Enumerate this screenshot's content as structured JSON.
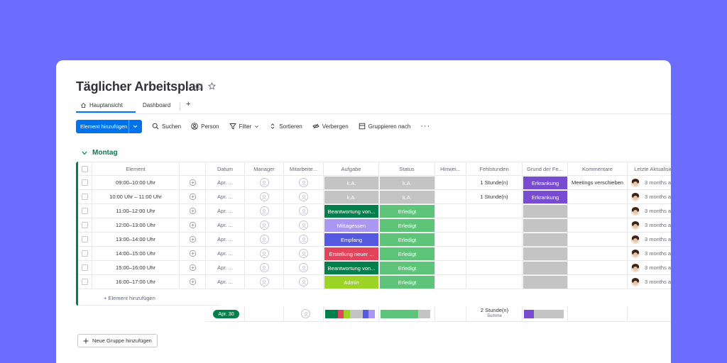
{
  "title": "Täglicher Arbeitsplan",
  "tabs": [
    {
      "label": "Hauptansicht",
      "icon": "home-icon"
    },
    {
      "label": "Dashboard"
    },
    {
      "label": "+"
    }
  ],
  "toolbar": {
    "primary": "Element hinzufügen",
    "items": [
      {
        "label": "Suchen",
        "icon": "search-icon"
      },
      {
        "label": "Person",
        "icon": "person-icon"
      },
      {
        "label": "Filter",
        "icon": "filter-icon"
      },
      {
        "label": "Sortieren",
        "icon": "sort-icon"
      },
      {
        "label": "Verbergen",
        "icon": "eye-off-icon"
      },
      {
        "label": "Gruppieren nach",
        "icon": "group-icon"
      }
    ],
    "more": "···"
  },
  "group": {
    "title": "Montag",
    "color": "#037f4c",
    "columns": [
      "Element",
      "Datum",
      "Manager",
      "Mitarbeite...",
      "Aufgabe",
      "Status",
      "Hinwei...",
      "Fehlstunden",
      "Grund der Fe...",
      "Kommentare",
      "Letzte Aktualisie..."
    ],
    "rows": [
      {
        "element": "09:00–10:00 Uhr",
        "datum": "Apr. ...",
        "aufgabe": "k.A.",
        "aufgabe_color": "#c4c4c4",
        "status": "k.A.",
        "status_color": "#c4c4c4",
        "fehlstunden": "1 Stunde(n)",
        "grund": "Erkrankung",
        "grund_color": "#784bd1",
        "kommentar": "Meetings verschieben",
        "updated": "3 months a..."
      },
      {
        "element": "10:00 Uhr – 11:00 Uhr",
        "datum": "Apr. ...",
        "aufgabe": "k.A.",
        "aufgabe_color": "#c4c4c4",
        "status": "k.A.",
        "status_color": "#c4c4c4",
        "fehlstunden": "1 Stunde(n)",
        "grund": "Erkrankung",
        "grund_color": "#784bd1",
        "kommentar": "",
        "updated": "3 months a..."
      },
      {
        "element": "11:00–12:00 Uhr",
        "datum": "Apr. ...",
        "aufgabe": "Beantwortung von...",
        "aufgabe_color": "#037f4c",
        "status": "Erledigt",
        "status_color": "#5ec47a",
        "fehlstunden": "",
        "grund": "",
        "grund_color": "#c4c4c4",
        "kommentar": "",
        "updated": "3 months a..."
      },
      {
        "element": "12:00–13:00 Uhr",
        "datum": "Apr. ...",
        "aufgabe": "Mittagessen",
        "aufgabe_color": "#a997f0",
        "status": "Erledigt",
        "status_color": "#5ec47a",
        "fehlstunden": "",
        "grund": "",
        "grund_color": "#c4c4c4",
        "kommentar": "",
        "updated": "3 months a..."
      },
      {
        "element": "13:00–14:00 Uhr",
        "datum": "Apr. ...",
        "aufgabe": "Empfang",
        "aufgabe_color": "#5559df",
        "status": "Erledigt",
        "status_color": "#5ec47a",
        "fehlstunden": "",
        "grund": "",
        "grund_color": "#c4c4c4",
        "kommentar": "",
        "updated": "3 months a..."
      },
      {
        "element": "14:00–15:00 Uhr",
        "datum": "Apr. ...",
        "aufgabe": "Erstellung neuer ...",
        "aufgabe_color": "#e2445c",
        "status": "Erledigt",
        "status_color": "#5ec47a",
        "fehlstunden": "",
        "grund": "",
        "grund_color": "#c4c4c4",
        "kommentar": "",
        "updated": "3 months a..."
      },
      {
        "element": "15:00–16:00 Uhr",
        "datum": "Apr. ...",
        "aufgabe": "Beantwortung von...",
        "aufgabe_color": "#037f4c",
        "status": "Erledigt",
        "status_color": "#5ec47a",
        "fehlstunden": "",
        "grund": "",
        "grund_color": "#c4c4c4",
        "kommentar": "",
        "updated": "3 months a..."
      },
      {
        "element": "16:00–17:00 Uhr",
        "datum": "Apr. ...",
        "aufgabe": "Admin",
        "aufgabe_color": "#9cd326",
        "status": "Erledigt",
        "status_color": "#5ec47a",
        "fehlstunden": "",
        "grund": "",
        "grund_color": "#c4c4c4",
        "kommentar": "",
        "updated": "3 months a..."
      }
    ],
    "add_item": "+ Element hinzufügen",
    "summary": {
      "datum": "Apr. 30",
      "fehlstunden": "2 Stunde(n)",
      "fehlstunden_sub": "Summe",
      "aufgabe_segments": [
        {
          "color": "#037f4c",
          "share": 0.25
        },
        {
          "color": "#e2445c",
          "share": 0.125
        },
        {
          "color": "#9cd326",
          "share": 0.125
        },
        {
          "color": "#c4c4c4",
          "share": 0.25
        },
        {
          "color": "#5559df",
          "share": 0.125
        },
        {
          "color": "#a997f0",
          "share": 0.125
        }
      ],
      "status_segments": [
        {
          "color": "#5ec47a",
          "share": 0.75
        },
        {
          "color": "#c4c4c4",
          "share": 0.25
        }
      ],
      "grund_segments": [
        {
          "color": "#784bd1",
          "share": 0.25
        },
        {
          "color": "#c4c4c4",
          "share": 0.75
        }
      ]
    }
  },
  "new_group": "Neue Gruppe hinzufügen"
}
